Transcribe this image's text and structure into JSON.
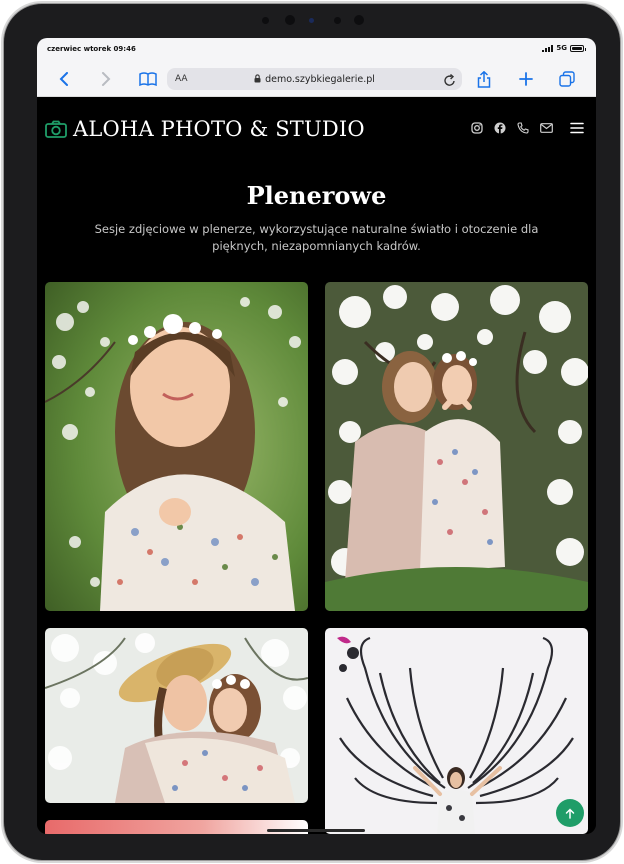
{
  "status_bar": {
    "time": "czerwiec wtorek 09:46",
    "network": "5G"
  },
  "browser": {
    "text_size_label": "AA",
    "url": "demo.szybkiegalerie.pl"
  },
  "site": {
    "brand": "ALOHA PHOTO & STUDIO",
    "nav_icons": [
      "instagram-icon",
      "facebook-icon",
      "phone-icon",
      "mail-icon",
      "menu-icon"
    ],
    "hero": {
      "title": "Plenerowe",
      "description": "Sesje zdjęciowe w plenerze, wykorzystujące naturalne światło i otoczenie dla pięknych, niezapomnianych kadrów."
    },
    "gallery": [
      "girl-flower-crown",
      "mother-daughter-blossoms",
      "mother-hat-hug",
      "angel-wings-mural",
      "partial-photo"
    ]
  },
  "colors": {
    "accent": "#1f9d68",
    "background": "#000000",
    "logo_icon": "#1f9d68"
  }
}
